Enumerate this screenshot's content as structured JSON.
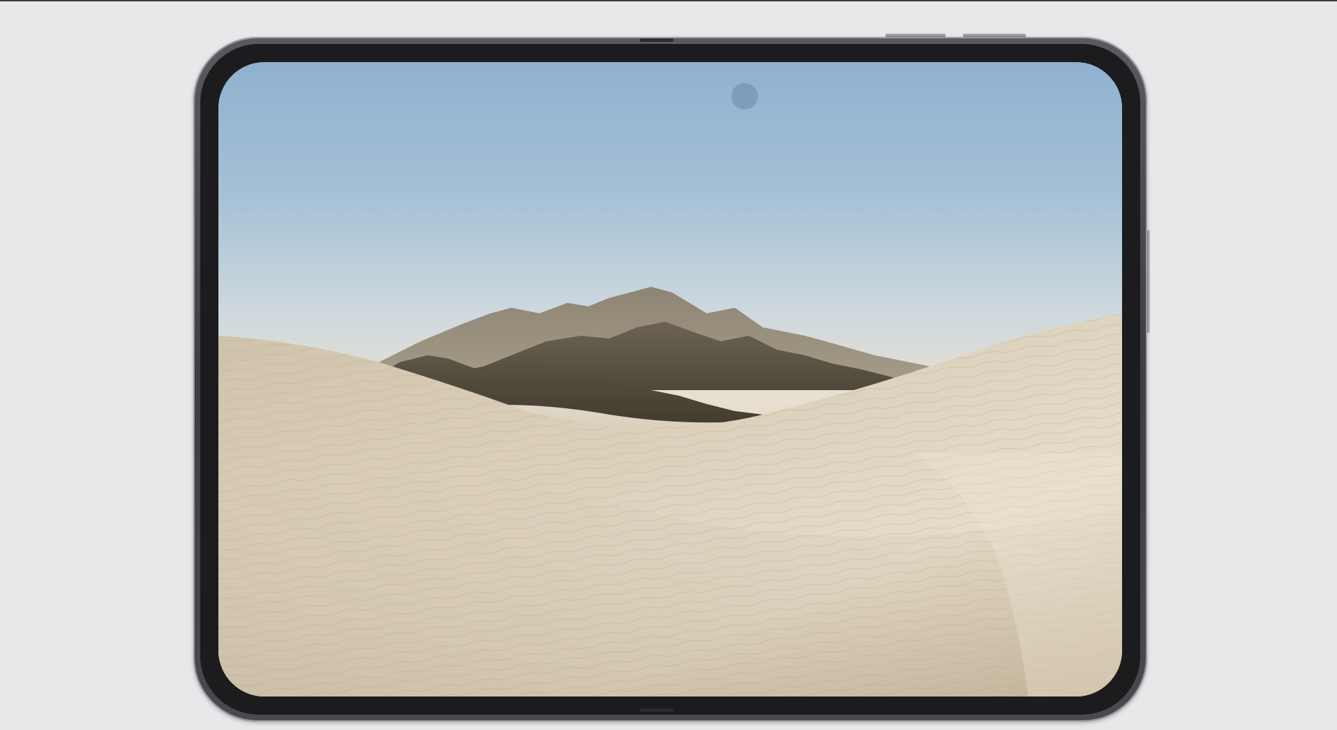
{
  "screen": {
    "wallpaper": "desert-dunes-mountains-wallpaper",
    "sky_top_color": "#8fb0cf",
    "sky_horizon_color": "#e9dcc6",
    "dune_color": "#d9ccb6",
    "mountain_color": "#5d5648"
  },
  "device": {
    "frame_color": "#4a4a4e",
    "bezel_color": "#1c1c1e"
  }
}
